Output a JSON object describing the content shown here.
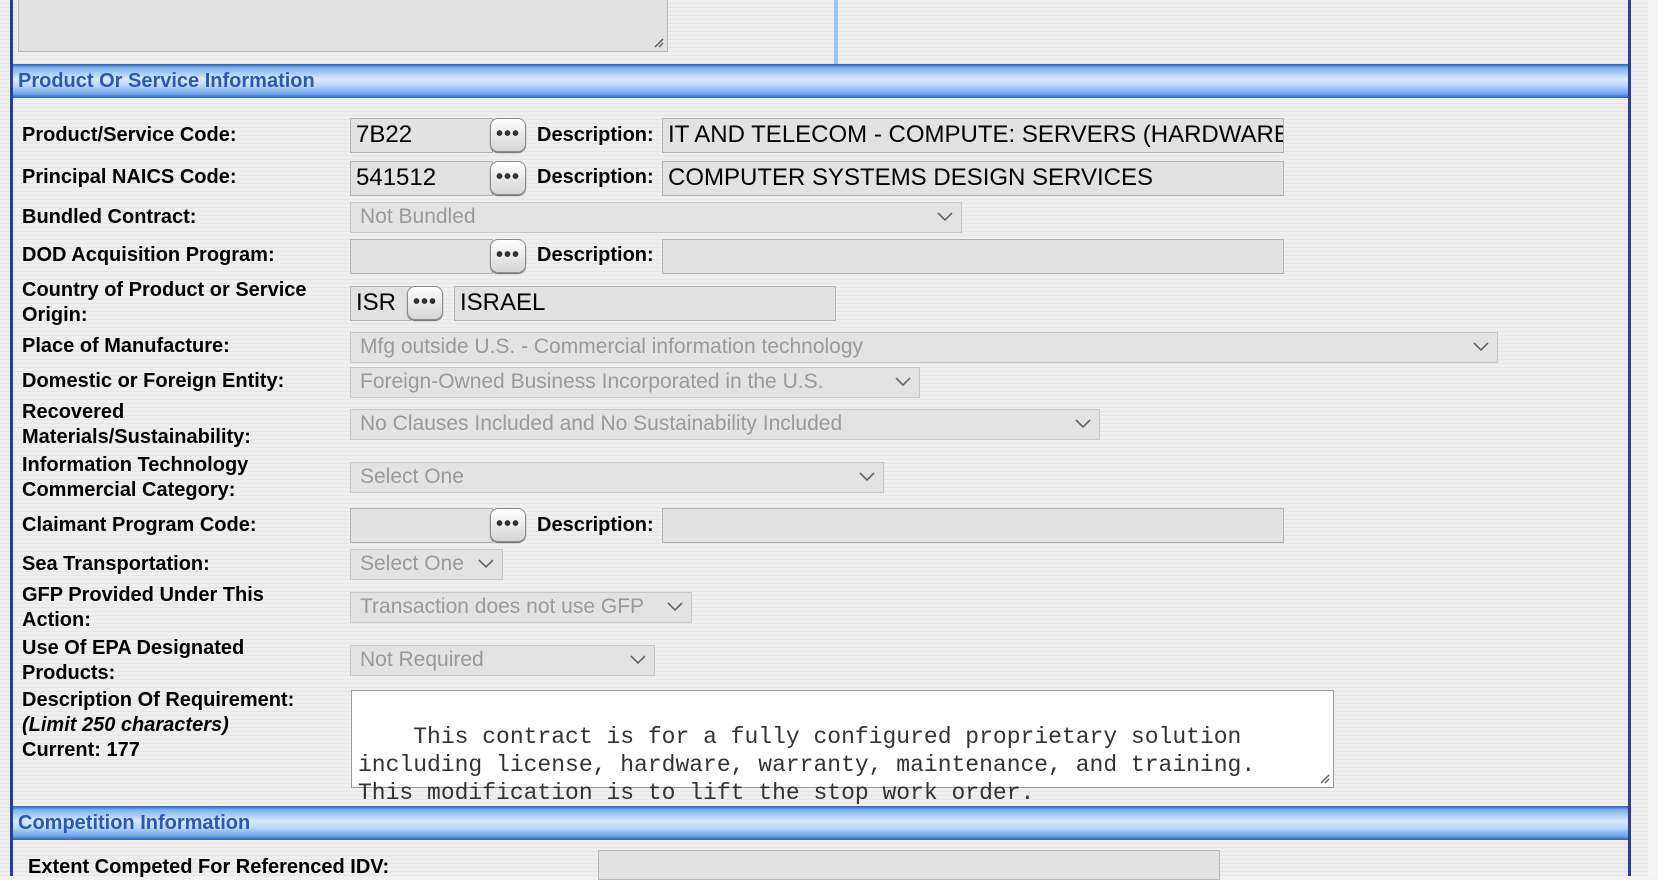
{
  "sections": {
    "product": "Product Or Service Information",
    "competition": "Competition Information"
  },
  "fields": {
    "psc": {
      "label": "Product/Service Code:",
      "value": "7B22",
      "desc_label": "Description:",
      "desc": "IT AND TELECOM - COMPUTE: SERVERS (HARDWARE"
    },
    "naics": {
      "label": "Principal NAICS Code:",
      "value": "541512",
      "desc_label": "Description:",
      "desc": "COMPUTER SYSTEMS DESIGN SERVICES"
    },
    "bundled": {
      "label": "Bundled Contract:",
      "value": "Not Bundled"
    },
    "dod": {
      "label": "DOD Acquisition Program:",
      "value": "",
      "desc_label": "Description:",
      "desc": ""
    },
    "country": {
      "label_line1": "Country of Product or Service",
      "label_line2": "Origin:",
      "code": "ISR",
      "name": "ISRAEL"
    },
    "manufacture": {
      "label": "Place of Manufacture:",
      "value": "Mfg outside U.S. - Commercial information technology"
    },
    "entity": {
      "label": "Domestic or Foreign Entity:",
      "value": "Foreign-Owned Business Incorporated in the U.S."
    },
    "recovered": {
      "label_line1": "Recovered",
      "label_line2": "Materials/Sustainability:",
      "value": "No Clauses Included and No Sustainability Included"
    },
    "itcat": {
      "label_line1": "Information Technology",
      "label_line2": "Commercial Category:",
      "value": "Select One"
    },
    "claimant": {
      "label": "Claimant Program Code:",
      "value": "",
      "desc_label": "Description:",
      "desc": ""
    },
    "sea": {
      "label": "Sea Transportation:",
      "value": "Select One"
    },
    "gfp": {
      "label_line1": "GFP Provided Under This",
      "label_line2": "Action:",
      "value": "Transaction does not use GFP"
    },
    "epa": {
      "label_line1": "Use Of EPA Designated",
      "label_line2": "Products:",
      "value": "Not Required"
    },
    "requirement": {
      "label": "Description Of Requirement:",
      "limit": "(Limit 250 characters)",
      "current": "Current: 177",
      "text": "This contract is for a fully configured proprietary solution\nincluding license, hardware, warranty, maintenance, and training.\nThis modification is to lift the stop work order."
    },
    "competed": {
      "label": "Extent Competed For Referenced IDV:"
    }
  },
  "icons": {
    "lookup": "ellipsis-lookup-icon",
    "dropdown": "chevron-down-icon",
    "resize": "resize-grip-icon"
  }
}
